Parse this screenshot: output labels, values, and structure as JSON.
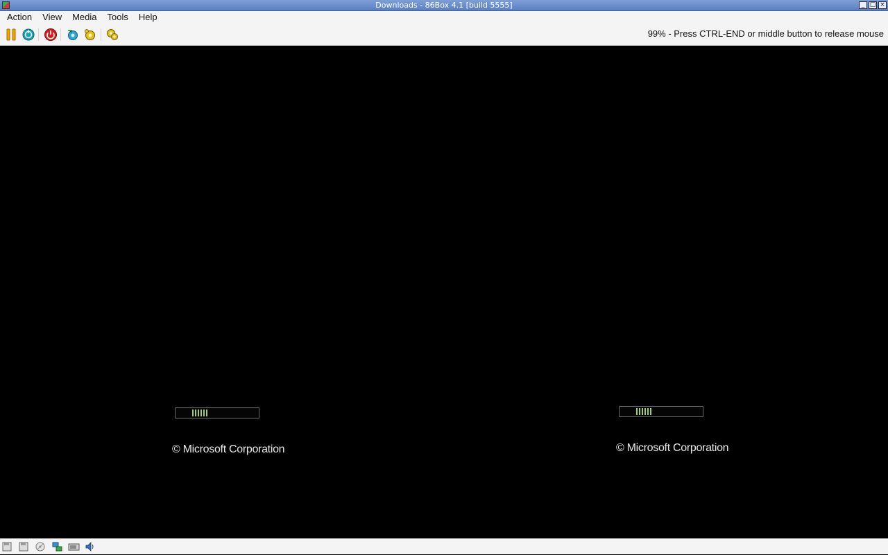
{
  "window": {
    "title": "Downloads - 86Box 4.1 [build 5555]"
  },
  "menubar": {
    "items": [
      {
        "label": "Action",
        "name": "menu-action"
      },
      {
        "label": "View",
        "name": "menu-view"
      },
      {
        "label": "Media",
        "name": "menu-media"
      },
      {
        "label": "Tools",
        "name": "menu-tools"
      },
      {
        "label": "Help",
        "name": "menu-help"
      }
    ]
  },
  "toolbar": {
    "buttons": [
      {
        "icon": "pause-icon",
        "color": "#f0a500"
      },
      {
        "icon": "ctrl-alt-del-icon",
        "color": "#1aa3b8"
      },
      {
        "icon": "power-icon",
        "color": "#d31f1f"
      },
      {
        "icon": "hard-reset-icon",
        "color": "#2aa9d6"
      },
      {
        "icon": "settings-icon",
        "color": "#e4c21a"
      },
      {
        "icon": "machine-settings-icon",
        "color": "#e4c21a"
      }
    ],
    "status_message": "99% - Press CTRL-END or middle button to release mouse"
  },
  "screen": {
    "boot_panels": [
      {
        "copyright": "© Microsoft Corporation"
      },
      {
        "copyright": "© Microsoft Corporation"
      }
    ],
    "progress_color": "#a8d24a"
  },
  "statusbar": {
    "icons": [
      "floppy-drive-1-icon",
      "floppy-drive-2-icon",
      "cdrom-drive-icon",
      "network-icon",
      "hard-disk-icon",
      "sound-icon"
    ]
  }
}
